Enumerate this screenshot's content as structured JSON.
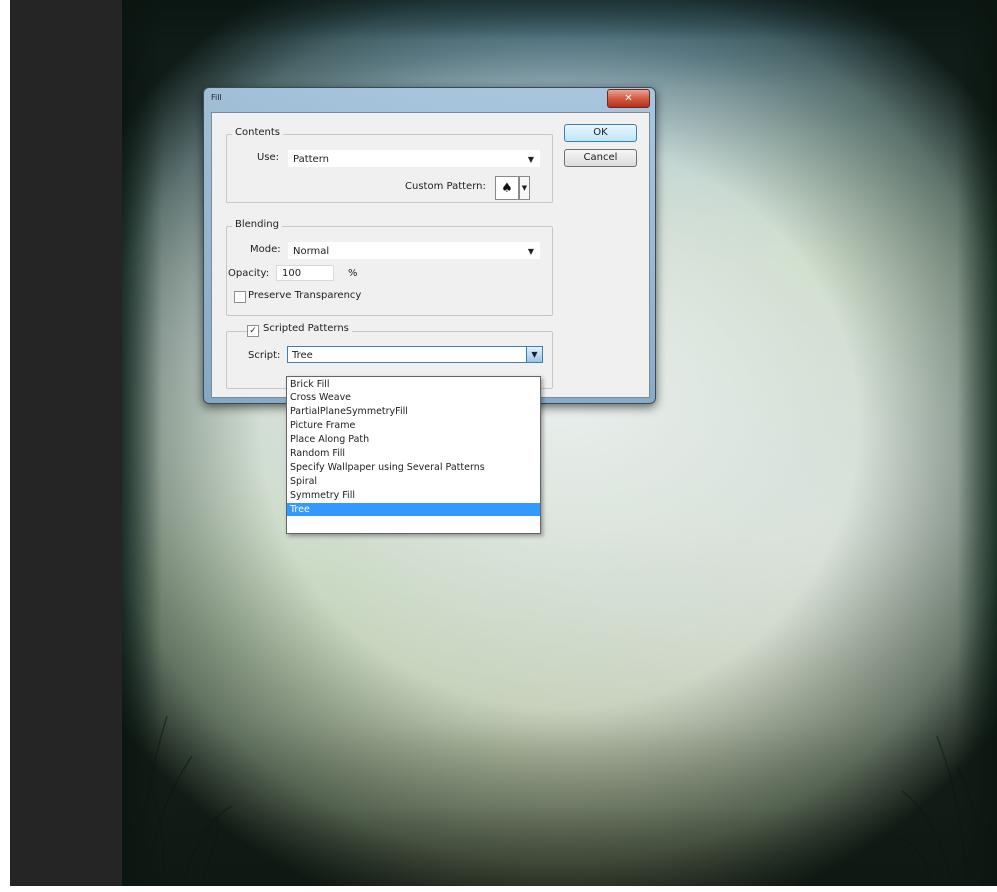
{
  "dialog": {
    "title": "Fill",
    "close_symbol": "✕",
    "ok_label": "OK",
    "cancel_label": "Cancel"
  },
  "contents": {
    "legend": "Contents",
    "use_label": "Use:",
    "use_value": "Pattern",
    "custom_pattern_label": "Custom Pattern:",
    "pattern_icon": "tree-pattern-icon"
  },
  "blending": {
    "legend": "Blending",
    "mode_label": "Mode:",
    "mode_value": "Normal",
    "opacity_label": "Opacity:",
    "opacity_value": "100",
    "opacity_unit": "%",
    "preserve_transparency_label": "Preserve Transparency",
    "preserve_transparency_checked": false
  },
  "scripted": {
    "legend": "Scripted Patterns",
    "checked": true,
    "script_label": "Script:",
    "script_value": "Tree"
  },
  "script_options": [
    "Brick Fill",
    "Cross Weave",
    "PartialPlaneSymmetryFill",
    "Picture Frame",
    "Place Along Path",
    "Random Fill",
    "Specify Wallpaper using Several Patterns",
    "Spiral",
    "Symmetry Fill",
    "Tree"
  ],
  "selected_script_index": 9,
  "colors": {
    "selection": "#3399ff",
    "close_button": "#d35b42",
    "workspace": "#252525"
  }
}
